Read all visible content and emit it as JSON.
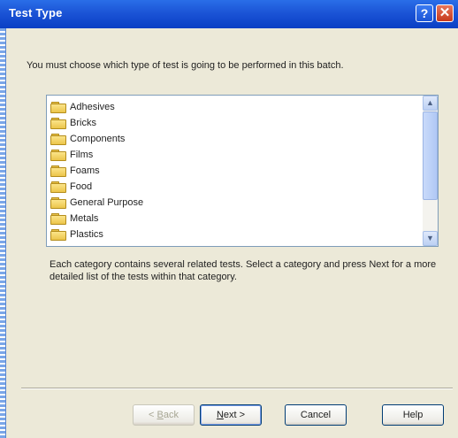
{
  "window": {
    "title": "Test Type",
    "help_glyph": "?",
    "close_glyph": "✕"
  },
  "prompt": "You must choose which type of test is going to be performed in this batch.",
  "list": {
    "items": [
      {
        "label": "Adhesives",
        "icon": "folder-icon"
      },
      {
        "label": "Bricks",
        "icon": "folder-icon"
      },
      {
        "label": "Components",
        "icon": "folder-icon"
      },
      {
        "label": "Films",
        "icon": "folder-icon"
      },
      {
        "label": "Foams",
        "icon": "folder-icon"
      },
      {
        "label": "Food",
        "icon": "folder-icon"
      },
      {
        "label": "General Purpose",
        "icon": "folder-icon"
      },
      {
        "label": "Metals",
        "icon": "folder-icon"
      },
      {
        "label": "Plastics",
        "icon": "folder-icon"
      }
    ],
    "scroll_up_glyph": "▲",
    "scroll_down_glyph": "▼"
  },
  "description": "Each category contains several related tests. Select a category and press Next for a more detailed list of the tests within that category.",
  "buttons": {
    "back": {
      "prefix": "< ",
      "mnemonic": "B",
      "rest": "ack"
    },
    "next": {
      "mnemonic": "N",
      "rest": "ext >"
    },
    "cancel": "Cancel",
    "help": "Help"
  },
  "colors": {
    "titlebar": "#0a3fc4",
    "dialog_bg": "#ece9d8",
    "close_button": "#c6391c"
  }
}
